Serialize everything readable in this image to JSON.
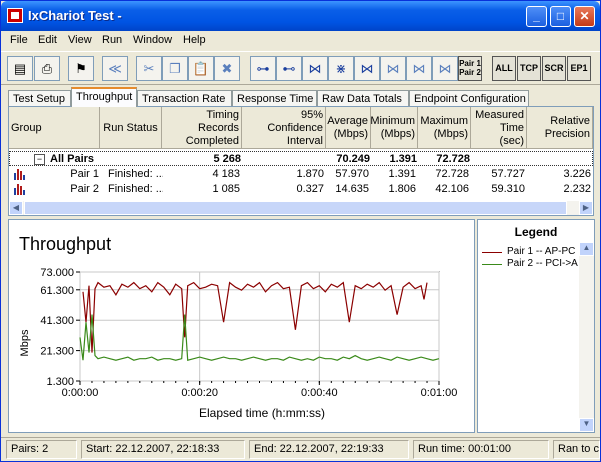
{
  "window": {
    "title": "IxChariot Test -"
  },
  "menu": [
    "File",
    "Edit",
    "View",
    "Run",
    "Window",
    "Help"
  ],
  "toolbar": {
    "pair_button": [
      "Pair 1",
      "Pair 2"
    ],
    "text_buttons": [
      "ALL",
      "TCP",
      "SCR",
      "EP1"
    ]
  },
  "tabs": [
    "Test Setup",
    "Throughput",
    "Transaction Rate",
    "Response Time",
    "Raw Data Totals",
    "Endpoint Configuration"
  ],
  "active_tab": "Throughput",
  "table": {
    "headers": {
      "group": "Group",
      "run_status": "Run Status",
      "timing_records": "Timing Records Completed",
      "confidence": "95% Confidence Interval",
      "average": "Average (Mbps)",
      "minimum": "Minimum (Mbps)",
      "maximum": "Maximum (Mbps)",
      "measured_time": "Measured Time (sec)",
      "relative_precision": "Relative Precision"
    },
    "all_pairs": {
      "group": "All Pairs",
      "timing_records": "5 268",
      "average": "70.249",
      "minimum": "1.391",
      "maximum": "72.728"
    },
    "rows": [
      {
        "group": "Pair 1",
        "status": "Finished: ...",
        "timing_records": "4 183",
        "confidence": "1.870",
        "average": "57.970",
        "minimum": "1.391",
        "maximum": "72.728",
        "measured_time": "57.727",
        "relative_precision": "3.226"
      },
      {
        "group": "Pair 2",
        "status": "Finished: ...",
        "timing_records": "1 085",
        "confidence": "0.327",
        "average": "14.635",
        "minimum": "1.806",
        "maximum": "42.106",
        "measured_time": "59.310",
        "relative_precision": "2.232"
      }
    ]
  },
  "chart": {
    "title": "Throughput",
    "ylabel": "Mbps",
    "xlabel": "Elapsed time (h:mm:ss)"
  },
  "legend": {
    "title": "Legend"
  },
  "chart_data": {
    "type": "line",
    "title": "Throughput",
    "xlabel": "Elapsed time (h:mm:ss)",
    "ylabel": "Mbps",
    "yticks": [
      "73.000",
      "61.300",
      "41.300",
      "21.300",
      "1.300"
    ],
    "ytick_values": [
      73.0,
      61.3,
      41.3,
      21.3,
      1.3
    ],
    "xticks": [
      "0:00:00",
      "0:00:20",
      "0:00:40",
      "0:01:00"
    ],
    "xtick_values": [
      0,
      20,
      40,
      60
    ],
    "ylim": [
      1.3,
      73.0
    ],
    "xlim": [
      0,
      60
    ],
    "grid": true,
    "series": [
      {
        "name": "Pair 1 -- AP-PC",
        "color": "#8b0000",
        "x": [
          0.5,
          1,
          1.5,
          2,
          2.5,
          3,
          4,
          5,
          6,
          7,
          8,
          9,
          10,
          11,
          12,
          13,
          14,
          15,
          16,
          17,
          17.5,
          18,
          19,
          20,
          21,
          22,
          23,
          24,
          25,
          26,
          27,
          28,
          29,
          30,
          31,
          32,
          33,
          34,
          35,
          36,
          37,
          38,
          39,
          40,
          41,
          42,
          43,
          44,
          45,
          46,
          47,
          48,
          49,
          50,
          51,
          52,
          53,
          54,
          55,
          56,
          57,
          57.5,
          58
        ],
        "y": [
          60,
          40,
          64,
          20,
          62,
          66,
          63,
          64,
          58,
          65,
          63,
          66,
          62,
          64,
          60,
          66,
          63,
          58,
          65,
          62,
          30,
          64,
          66,
          62,
          63,
          65,
          64,
          40,
          66,
          63,
          61,
          65,
          63,
          66,
          60,
          64,
          66,
          62,
          63,
          35,
          64,
          66,
          62,
          64,
          60,
          65,
          63,
          66,
          40,
          64,
          62,
          65,
          63,
          66,
          61,
          64,
          45,
          63,
          66,
          62,
          64,
          55,
          66
        ]
      },
      {
        "name": "Pair 2 -- PCI->A",
        "color": "#3a8a1a",
        "x": [
          0,
          0.5,
          1,
          1.5,
          2,
          2.5,
          3,
          4,
          5,
          6,
          7,
          8,
          9,
          10,
          11,
          12,
          13,
          14,
          15,
          16,
          17,
          17.5,
          18,
          19,
          20,
          21,
          22,
          23,
          24,
          25,
          26,
          27,
          28,
          29,
          30,
          31,
          32,
          33,
          34,
          35,
          36,
          37,
          38,
          39,
          40,
          41,
          42,
          43,
          44,
          45,
          46,
          47,
          48,
          49,
          50,
          51,
          52,
          53,
          54,
          55,
          56,
          57,
          58,
          59,
          60
        ],
        "y": [
          30,
          15,
          40,
          20,
          45,
          18,
          16,
          17,
          16,
          15,
          16,
          17,
          15,
          16,
          16,
          17,
          15,
          16,
          16,
          15,
          16,
          45,
          15,
          16,
          17,
          16,
          15,
          16,
          17,
          16,
          16,
          15,
          16,
          17,
          16,
          15,
          16,
          16,
          15,
          17,
          16,
          15,
          16,
          15,
          17,
          16,
          16,
          15,
          17,
          16,
          18,
          16,
          15,
          16,
          17,
          16,
          15,
          17,
          16,
          15,
          16,
          17,
          16,
          15,
          16
        ]
      }
    ]
  },
  "status": {
    "pairs": "Pairs: 2",
    "start": "Start: 22.12.2007, 22:18:33",
    "end": "End: 22.12.2007, 22:19:33",
    "run_time": "Run time: 00:01:00",
    "ran_to": "Ran to c"
  }
}
